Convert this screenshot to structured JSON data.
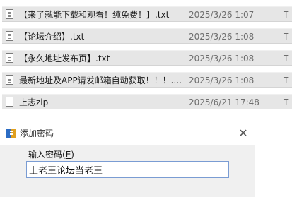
{
  "files": [
    {
      "name": "【来了就能下载和观看！纯免费！】.txt",
      "date": "2025/3/26 1:07",
      "extra": "T",
      "icon": "text-file-icon"
    },
    {
      "name": "【论坛介绍】.txt",
      "date": "2025/3/26 1:08",
      "extra": "T",
      "icon": "text-file-icon"
    },
    {
      "name": "【永久地址发布页】.txt",
      "date": "2025/3/26 1:08",
      "extra": "T",
      "icon": "text-file-icon"
    },
    {
      "name": "最新地址及APP请发邮箱自动获取！！！....",
      "date": "2025/3/26 1:08",
      "extra": "T",
      "icon": "text-file-icon"
    },
    {
      "name": "上志zip",
      "date": "2025/6/21 17:48",
      "extra": "T",
      "icon": "blank-file-icon"
    }
  ],
  "dialog": {
    "title": "添加密码",
    "close_glyph": "✕",
    "field_label": "输入密码(",
    "field_label_key": "E",
    "field_label_end": ")",
    "password_value": "上老王论坛当老王"
  },
  "colors": {
    "row_selected": "#e6e6e6",
    "input_border": "#7a9cd3",
    "dialog_bg": "#f0f0f0"
  }
}
